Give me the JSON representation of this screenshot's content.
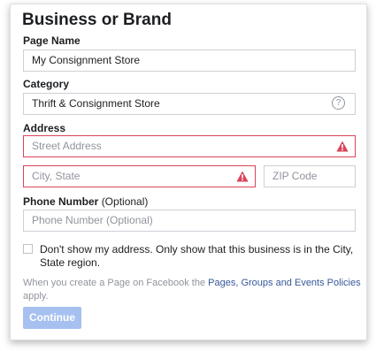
{
  "form": {
    "title": "Business or Brand",
    "page_name": {
      "label": "Page Name",
      "value": "My Consignment Store"
    },
    "category": {
      "label": "Category",
      "value": "Thrift & Consignment Store",
      "help_icon": "question-circle-icon",
      "help_glyph": "?"
    },
    "address": {
      "label": "Address",
      "street_placeholder": "Street Address",
      "city_placeholder": "City, State",
      "zip_placeholder": "ZIP Code",
      "error_icon": "warning-triangle-icon",
      "error_color": "#d9445a"
    },
    "phone": {
      "label": "Phone Number",
      "label_optional": "(Optional)",
      "placeholder": "Phone Number (Optional)"
    },
    "hide_address": {
      "checked": false,
      "text": "Don't show my address. Only show that this business is in the City, State region."
    },
    "policy": {
      "prefix": "When you create a Page on Facebook the ",
      "link": "Pages, Groups and Events Policies",
      "suffix": " apply."
    },
    "continue_label": "Continue",
    "colors": {
      "button_disabled": "#a6c0f0",
      "link": "#365899"
    }
  }
}
